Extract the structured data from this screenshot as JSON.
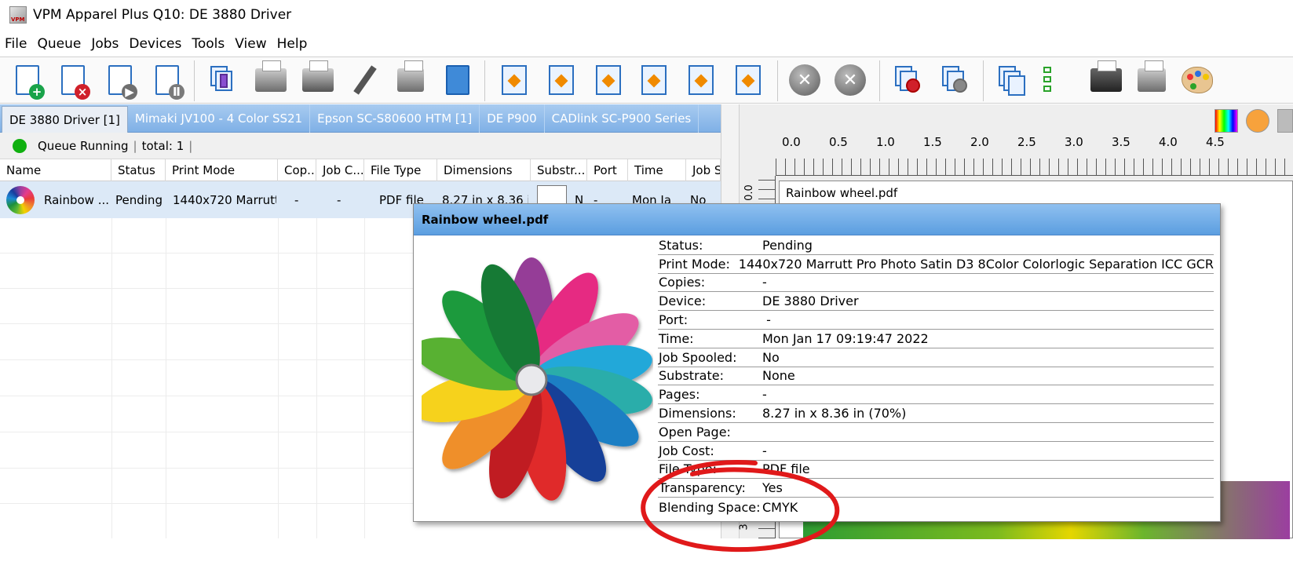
{
  "window": {
    "title": "VPM Apparel Plus Q10: DE 3880 Driver",
    "app_icon_text": "VPM"
  },
  "menu": [
    "File",
    "Queue",
    "Jobs",
    "Devices",
    "Tools",
    "View",
    "Help"
  ],
  "toolbar": {
    "icons": [
      "add-job-icon",
      "remove-job-icon",
      "play-job-icon",
      "pause-job-icon",
      "spool-icon",
      "print-icon",
      "print-color-icon",
      "pen-icon",
      "cutter-icon",
      "save-icon",
      "fit-center-icon",
      "fit-left-icon",
      "fit-middle-icon",
      "fit-vertical-icon",
      "fit-both-icon",
      "fit-top-icon",
      "cancel-gray-icon",
      "cancel-icon",
      "stop-queue-icon",
      "resume-queue-icon",
      "job-list-icon",
      "checklist-icon",
      "printer-settings-icon",
      "calculator-icon",
      "job-cost-icon",
      "palette-icon"
    ]
  },
  "tabs": [
    "DE 3880 Driver [1]",
    "Mimaki JV100 - 4 Color SS21",
    "Epson SC-S80600 HTM [1]",
    "DE P900",
    "CADlink SC-P900 Series"
  ],
  "queue": {
    "status": "Queue Running",
    "total_label": "total: 1"
  },
  "table": {
    "columns": [
      "Name",
      "Status",
      "Print Mode",
      "Cop...",
      "Job C...",
      "File Type",
      "Dimensions",
      "Substr...",
      "Port",
      "Time",
      "Job S"
    ],
    "rows": [
      {
        "name": "Rainbow ...",
        "status": "Pending",
        "print_mode": "1440x720 Marrutt...",
        "copies": "-",
        "job_cost": "-",
        "file_type": "PDF file",
        "dimensions": "8.27 in x 8.36 i",
        "substrate": "N",
        "port": "-",
        "time": "Mon Ja",
        "job_spooled": "No"
      }
    ]
  },
  "preview": {
    "ruler_labels": [
      "0.0",
      "0.5",
      "1.0",
      "1.5",
      "2.0",
      "2.5",
      "3.0",
      "3.5",
      "4.0",
      "4.5"
    ],
    "vertical_ruler_labels": [
      "0.0",
      "3"
    ],
    "document_title": "Rainbow wheel.pdf"
  },
  "popup": {
    "title": "Rainbow wheel.pdf",
    "properties": [
      {
        "label": "Status:",
        "value": "Pending"
      },
      {
        "label": "Print Mode:",
        "value": "1440x720 Marrutt Pro Photo Satin D3 8Color Colorlogic Separation ICC GCR"
      },
      {
        "label": "Copies:",
        "value": "-"
      },
      {
        "label": "Device:",
        "value": "DE 3880 Driver"
      },
      {
        "label": "Port:",
        "value": " -"
      },
      {
        "label": "Time:",
        "value": "Mon Jan 17 09:19:47 2022"
      },
      {
        "label": "Job Spooled:",
        "value": "No"
      },
      {
        "label": "Substrate:",
        "value": "None"
      },
      {
        "label": "Pages:",
        "value": "-"
      },
      {
        "label": "Dimensions:",
        "value": "8.27 in x 8.36 in (70%)"
      },
      {
        "label": "Open Page:",
        "value": ""
      },
      {
        "label": "Job Cost:",
        "value": "-"
      },
      {
        "label": "File Type:",
        "value": "PDF file"
      },
      {
        "label": "Transparency:",
        "value": "Yes"
      },
      {
        "label": "Blending Space:",
        "value": "CMYK"
      }
    ]
  },
  "colors": {
    "tab_bar": "#8ab8ea",
    "popup_header": "#74adea",
    "selected_row": "#dce9f7",
    "annotation": "#e0191a",
    "status_dot": "#10b010"
  }
}
